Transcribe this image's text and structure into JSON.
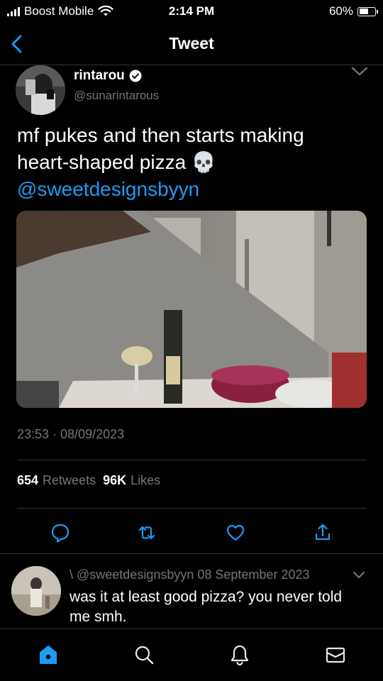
{
  "status_bar": {
    "carrier": "Boost Mobile",
    "time": "2:14 PM",
    "battery_label": "60%",
    "battery_level": 0.6
  },
  "header": {
    "title": "Tweet"
  },
  "tweet": {
    "author_name": "rintarou",
    "author_handle": "@sunarintarous",
    "text": "mf pukes and then starts making heart-shaped pizza 💀",
    "mention": "@sweetdesignsbyyn",
    "timestamp": "23:53 · 08/09/2023",
    "retweets_count": "654",
    "retweets_label": "Retweets",
    "likes_count": "96K",
    "likes_label": "Likes"
  },
  "reply": {
    "meta": "\\ @sweetdesignsbyyn 08 September 2023",
    "text": "was it at least good pizza? you never told me smh."
  },
  "colors": {
    "background": "#000000",
    "accent": "#1d9bf0",
    "secondary_text": "#71767b",
    "divider": "#2f3336"
  },
  "icons": {
    "back": "chevron-left-icon",
    "verified": "verified-badge-icon",
    "more": "chevron-down-icon",
    "reply": "comment-icon",
    "retweet": "retweet-icon",
    "like": "heart-icon",
    "share": "share-icon",
    "home": "home-icon",
    "search": "search-icon",
    "notifications": "bell-icon",
    "messages": "mail-icon"
  }
}
